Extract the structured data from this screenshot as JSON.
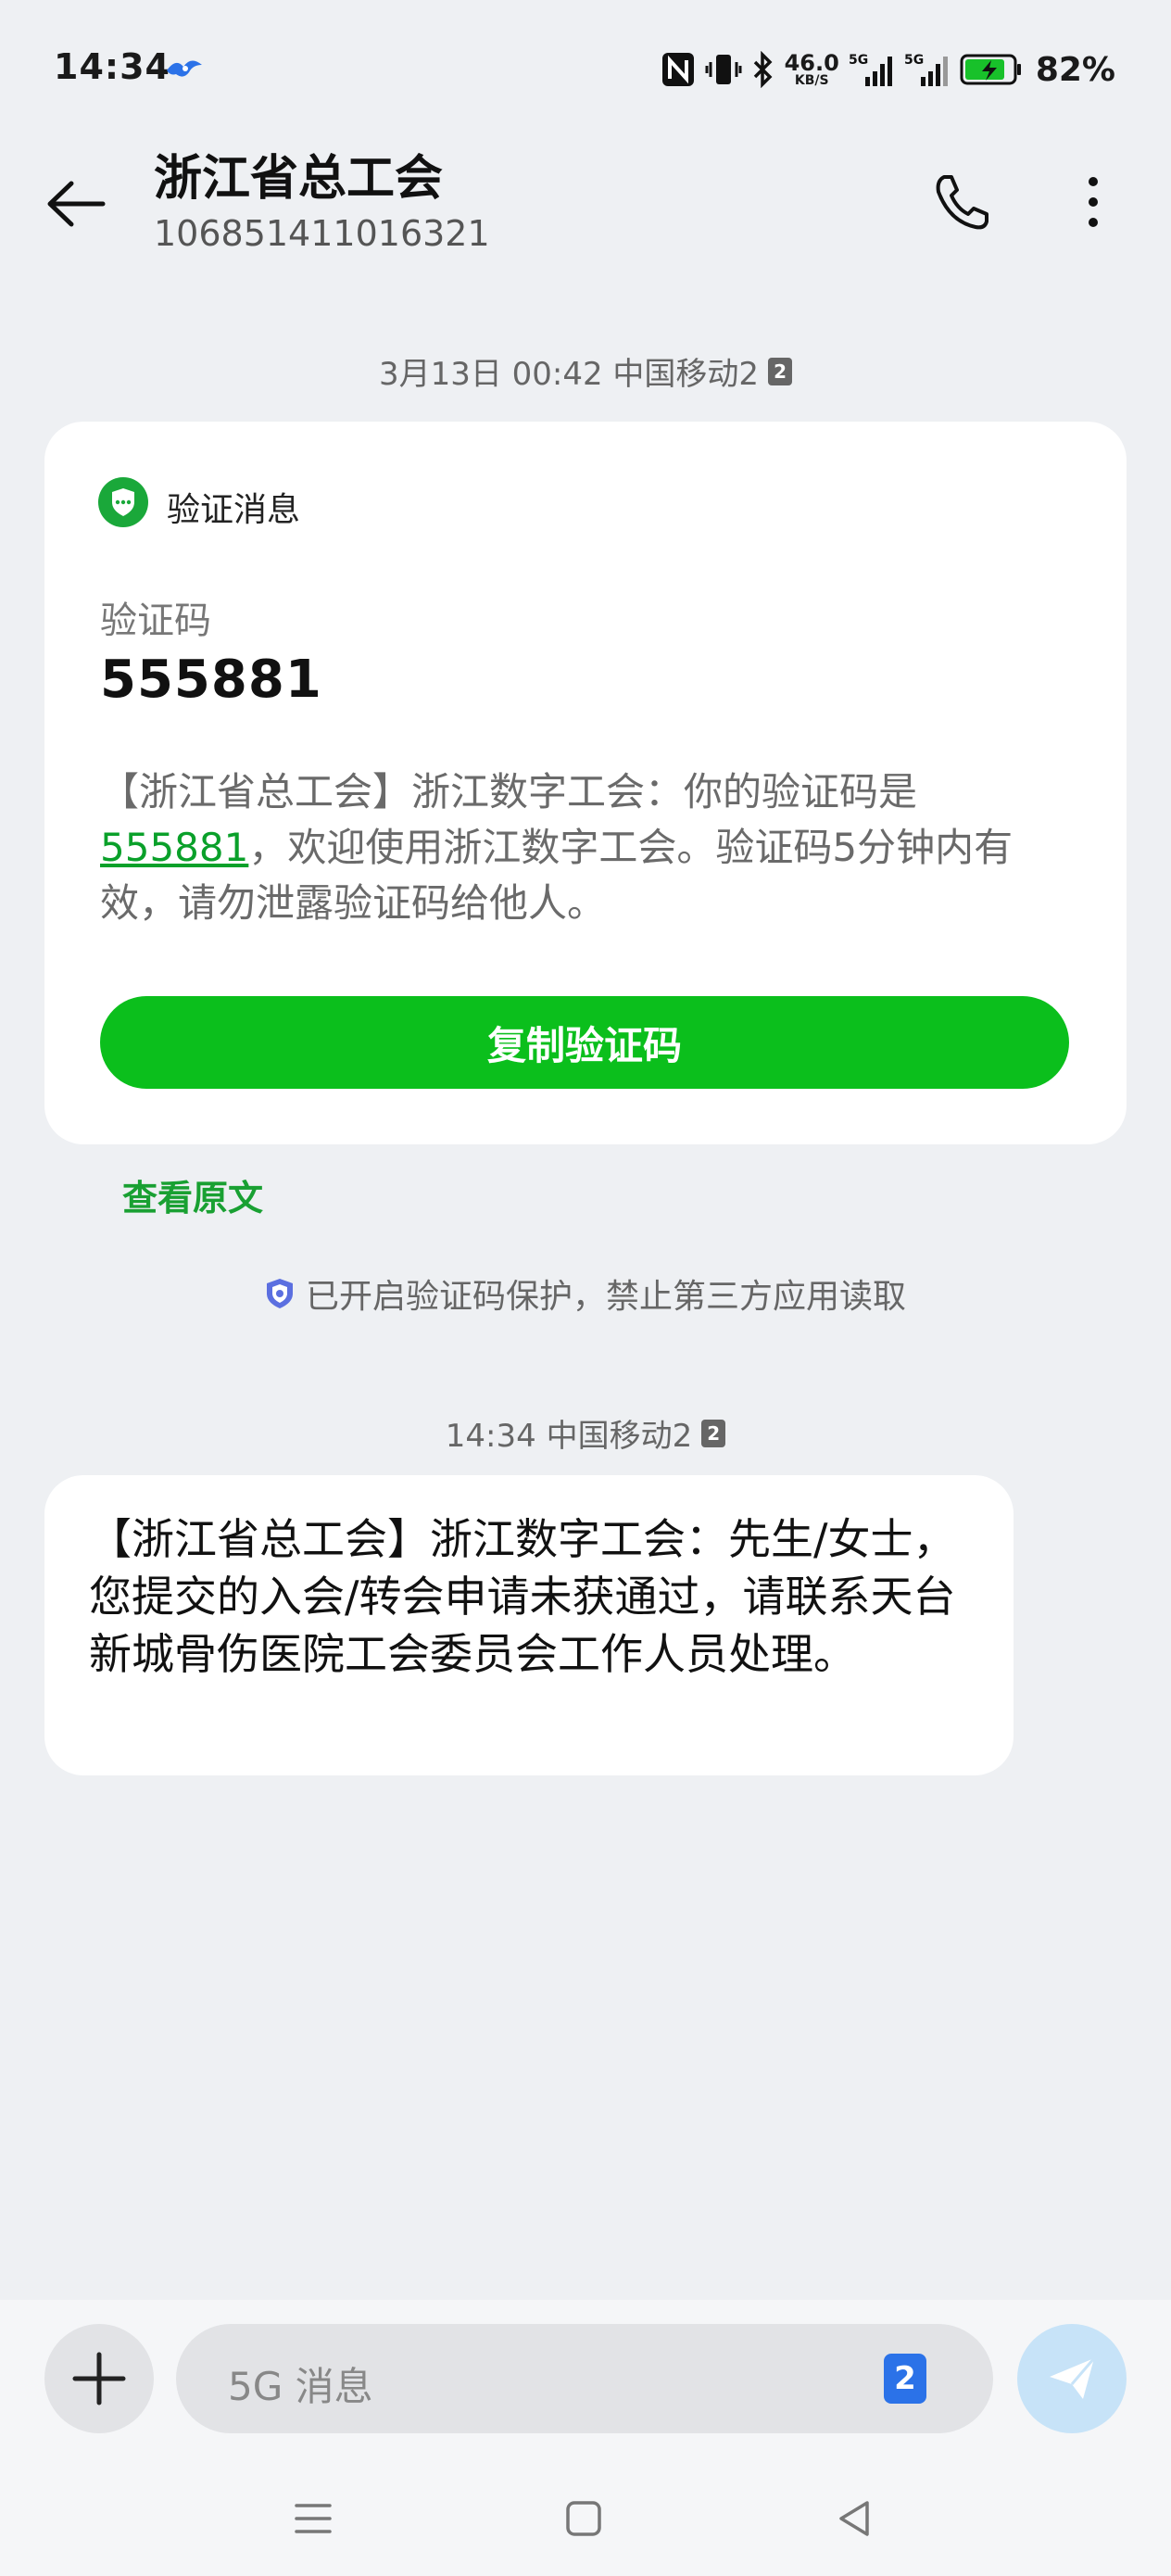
{
  "status_bar": {
    "time": "14:34",
    "net_speed_value": "46.0",
    "net_speed_unit": "KB/S",
    "signal_1": "5G",
    "signal_2": "5G",
    "battery": "82%",
    "icons": [
      "sim-bird-icon",
      "nfc-icon",
      "vibrate-icon",
      "bluetooth-icon",
      "signal-icon",
      "signal-icon",
      "battery-charging-icon"
    ]
  },
  "header": {
    "title": "浙江省总工会",
    "subtitle": "106851411016321"
  },
  "messages": [
    {
      "timestamp": "3月13日 00:42 中国移动2",
      "sim": "2"
    },
    {
      "timestamp": "14:34 中国移动2",
      "sim": "2"
    }
  ],
  "verification_card": {
    "label": "验证消息",
    "code_caption": "验证码",
    "code": "555881",
    "body_prefix": "【浙江省总工会】浙江数字工会：你的验证码是",
    "body_code": "555881",
    "body_suffix": "，欢迎使用浙江数字工会。验证码5分钟内有效，请勿泄露验证码给他人。",
    "copy_button": "复制验证码"
  },
  "view_original": "查看原文",
  "protection_notice": "已开启验证码保护，禁止第三方应用读取",
  "second_message": {
    "text": "【浙江省总工会】浙江数字工会：先生/女士，您提交的入会/转会申请未获通过，请联系天台新城骨伤医院工会委员会工作人员处理。"
  },
  "input_bar": {
    "placeholder": "5G 消息",
    "sim": "2"
  },
  "colors": {
    "accent_green": "#0bbf1c",
    "link_green": "#0aa02a",
    "send_bg": "#c7e3f8",
    "sim_blue": "#2b72e8",
    "background": "#eef0f3"
  }
}
